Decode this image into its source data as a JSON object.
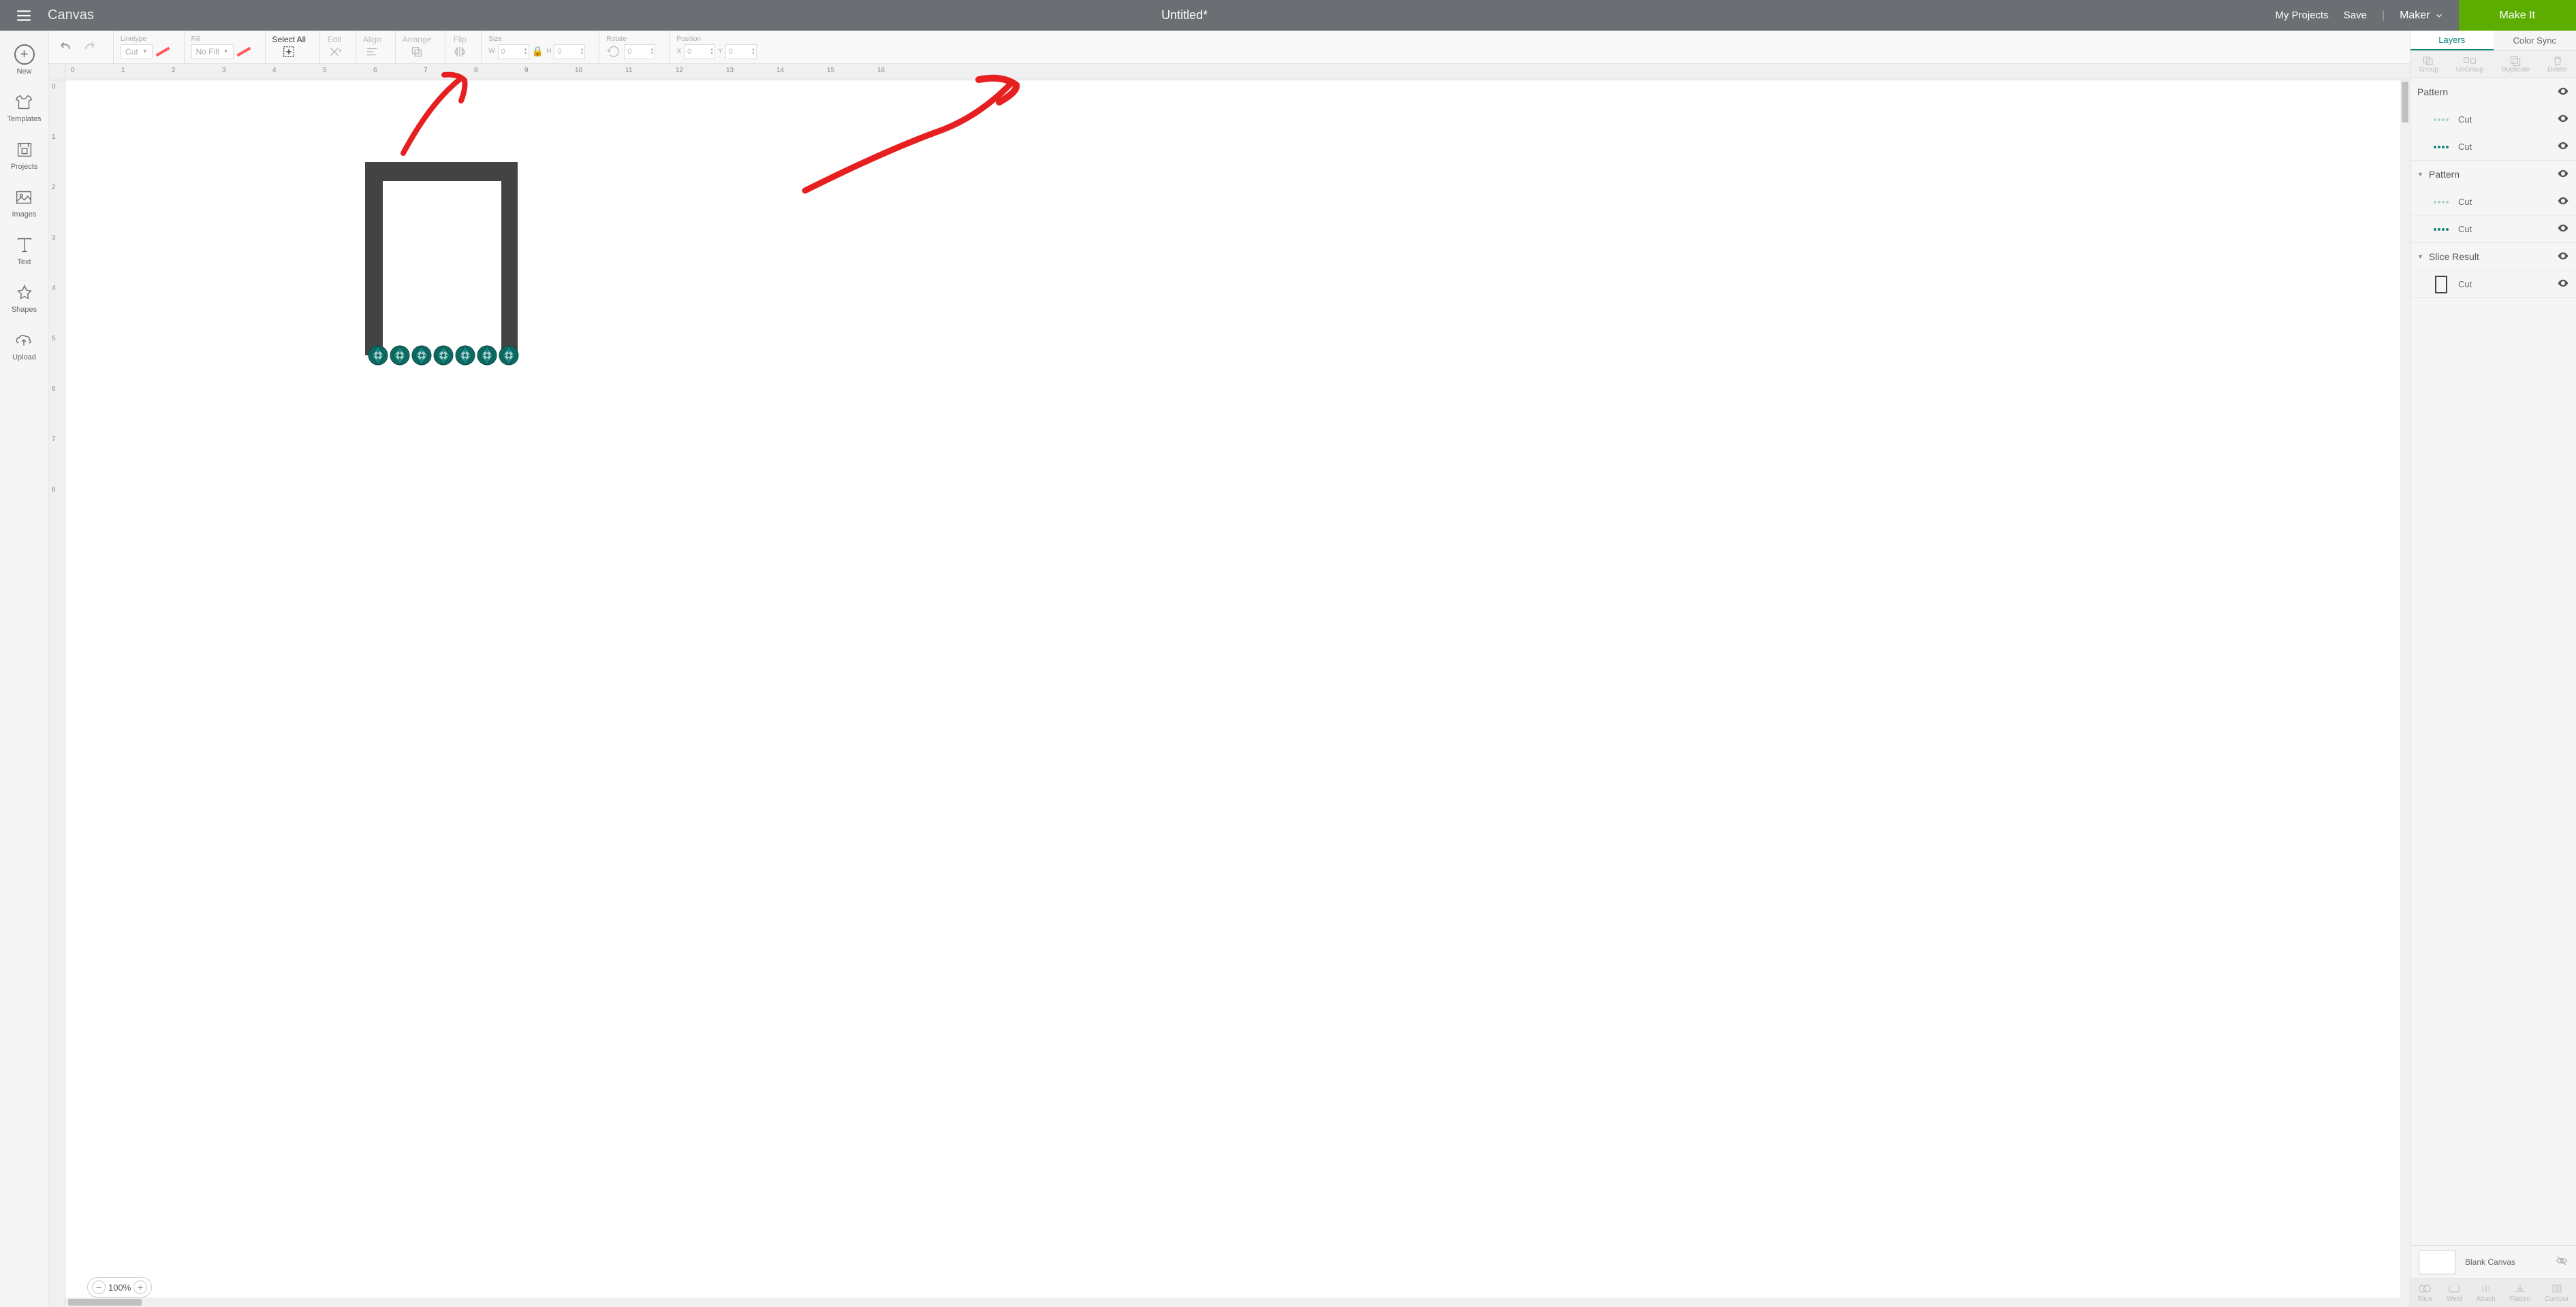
{
  "header": {
    "app_title": "Canvas",
    "doc_title": "Untitled*",
    "my_projects": "My Projects",
    "save": "Save",
    "machine": "Maker",
    "make_it": "Make It"
  },
  "left_tools": {
    "new": "New",
    "templates": "Templates",
    "projects": "Projects",
    "images": "Images",
    "text": "Text",
    "shapes": "Shapes",
    "upload": "Upload"
  },
  "topbar": {
    "linetype": {
      "label": "Linetype",
      "value": "Cut"
    },
    "fill": {
      "label": "Fill",
      "value": "No Fill"
    },
    "select_all": "Select All",
    "edit": "Edit",
    "align": "Align",
    "arrange": "Arrange",
    "flip": "Flip",
    "size": {
      "label": "Size",
      "w": "W",
      "wval": "0",
      "h": "H",
      "hval": "0"
    },
    "rotate": {
      "label": "Rotate",
      "val": "0"
    },
    "position": {
      "label": "Position",
      "x": "X",
      "xval": "0",
      "y": "Y",
      "yval": "0"
    }
  },
  "ruler": {
    "h": [
      "0",
      "1",
      "2",
      "3",
      "4",
      "5",
      "6",
      "7",
      "8",
      "9",
      "10",
      "11",
      "12",
      "13",
      "14",
      "15",
      "16"
    ],
    "v": [
      "0",
      "1",
      "2",
      "3",
      "4",
      "5",
      "6",
      "7",
      "8"
    ]
  },
  "zoom": "100%",
  "right_panel": {
    "tabs": {
      "layers": "Layers",
      "color_sync": "Color Sync"
    },
    "actions": {
      "group": "Group",
      "ungroup": "UnGroup",
      "duplicate": "Duplicate",
      "delete": "Delete"
    },
    "layers": [
      {
        "name": "Pattern",
        "expanded": false,
        "sublayers": [
          {
            "label": "Cut",
            "thumb": "dots-light"
          },
          {
            "label": "Cut",
            "thumb": "dots-dark"
          }
        ]
      },
      {
        "name": "Pattern",
        "expanded": true,
        "sublayers": [
          {
            "label": "Cut",
            "thumb": "dots-light"
          },
          {
            "label": "Cut",
            "thumb": "dots-dark"
          }
        ]
      },
      {
        "name": "Slice Result",
        "expanded": true,
        "sublayers": [
          {
            "label": "Cut",
            "thumb": "rect"
          }
        ]
      }
    ],
    "canvas_row": "Blank Canvas",
    "bottom": {
      "slice": "Slice",
      "weld": "Weld",
      "attach": "Attach",
      "flatten": "Flatten",
      "contour": "Contour"
    }
  }
}
